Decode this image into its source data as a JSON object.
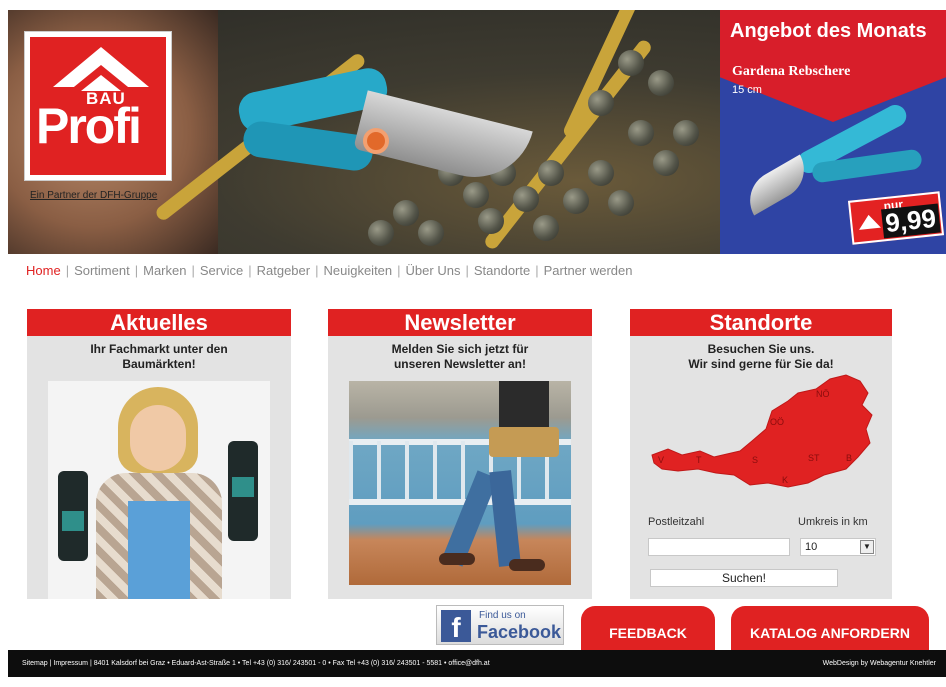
{
  "logo": {
    "bau": "BAU",
    "profi": "Profi"
  },
  "partner_link": "Ein Partner der DFH-Gruppe",
  "offer": {
    "title": "Angebot des Monats",
    "product": "Gardena Rebschere",
    "size": "15 cm",
    "price_prefix": "nur",
    "price": "9,99"
  },
  "nav": {
    "items": [
      "Home",
      "Sortiment",
      "Marken",
      "Service",
      "Ratgeber",
      "Neuigkeiten",
      "Über Uns",
      "Standorte",
      "Partner werden"
    ],
    "separator": "|"
  },
  "panels": {
    "aktuelles": {
      "title": "Aktuelles",
      "subtitle": "Ihr Fachmarkt unter den\nBaumärkten!"
    },
    "newsletter": {
      "title": "Newsletter",
      "subtitle": "Melden Sie sich jetzt für\nunseren Newsletter an!"
    },
    "standorte": {
      "title": "Standorte",
      "subtitle": "Besuchen Sie uns.\nWir sind gerne für Sie da!",
      "regions": [
        "NÖ",
        "OÖ",
        "V",
        "T",
        "S",
        "ST",
        "B",
        "K"
      ],
      "postcode_label": "Postleitzahl",
      "radius_label": "Umkreis in km",
      "radius_value": "10",
      "search_label": "Suchen!"
    }
  },
  "facebook": {
    "small": "Find us on",
    "big": "Facebook"
  },
  "buttons": {
    "feedback": "FEEDBACK",
    "catalog": "KATALOG ANFORDERN"
  },
  "footer": {
    "left": "Sitemap | Impressum | 8401 Kalsdorf bei Graz • Eduard-Ast-Straße 1 • Tel +43 (0) 316/ 243501 - 0 • Fax Tel +43 (0) 316/ 243501 - 5581 • office@dfh.at",
    "right": "WebDesign by Webagentur Knehtler"
  }
}
